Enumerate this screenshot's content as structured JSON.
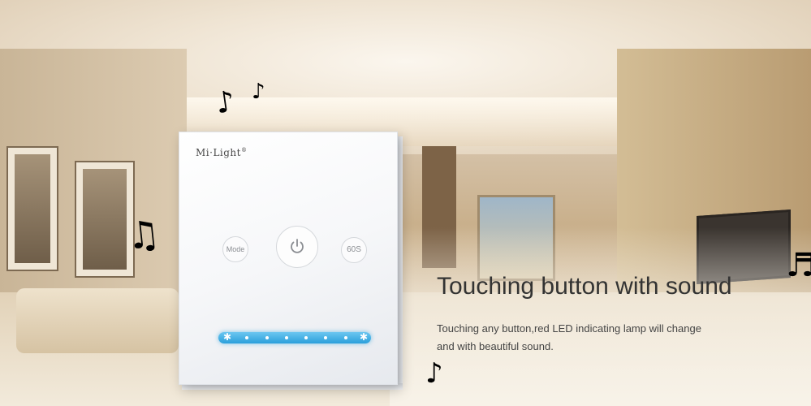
{
  "device": {
    "brand": "Mi·Light",
    "brand_reg": "®",
    "mode_label": "Mode",
    "timer_label": "60S",
    "power_icon": "power-icon",
    "led_color": "#2a9fdb"
  },
  "text": {
    "headline": "Touching button with sound",
    "description_line1": "Touching any button,red LED indicating lamp will change",
    "description_line2": "and with beautiful sound."
  },
  "decorations": {
    "music_note_icon": "music-note-icon",
    "note_1": "♪",
    "note_2": "♪",
    "note_3": "♫",
    "note_4": "♪",
    "note_5": "♬"
  }
}
